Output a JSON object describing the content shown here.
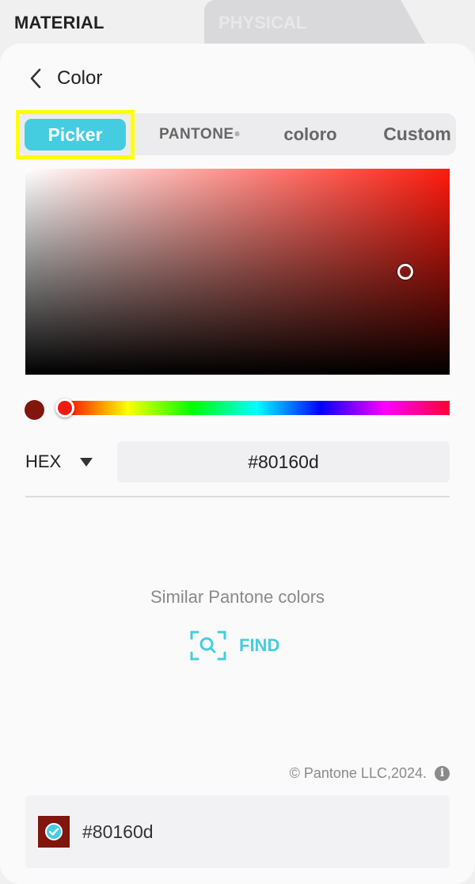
{
  "top_tabs": {
    "material": "MATERIAL",
    "physical": "PHYSICAL"
  },
  "header": {
    "back_icon": "chevron-left-icon",
    "title": "Color"
  },
  "mode_tabs": {
    "picker": "Picker",
    "pantone": "PANTONE",
    "pantone_mark": "®",
    "coloro": "coloro",
    "custom": "Custom",
    "active": "picker"
  },
  "picker": {
    "selected_color": "#80160d",
    "hue_color": "#ff1a0d",
    "format_label": "HEX",
    "format_caret_icon": "triangle-down-icon",
    "hex_value": "#80160d"
  },
  "similar": {
    "title": "Similar Pantone colors",
    "find_icon": "scan-search-icon",
    "find_label": "FIND"
  },
  "footer": {
    "copyright": "© Pantone LLC,2024.",
    "info_icon": "info-icon",
    "selected_hex": "#80160d",
    "selected_check_icon": "check-icon"
  },
  "colors": {
    "accent": "#44cde0",
    "highlight": "#ffff00",
    "swatch": "#80160d"
  }
}
